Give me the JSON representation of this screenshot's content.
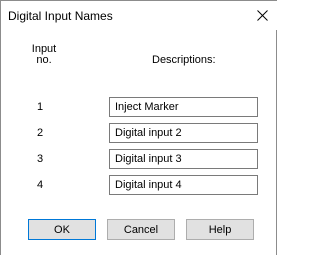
{
  "dialog": {
    "title": "Digital Input Names"
  },
  "headers": {
    "input_no_line1": "Input",
    "input_no_line2": "no.",
    "descriptions": "Descriptions:"
  },
  "rows": [
    {
      "no": "1",
      "description": "Inject Marker"
    },
    {
      "no": "2",
      "description": "Digital input 2"
    },
    {
      "no": "3",
      "description": "Digital input 3"
    },
    {
      "no": "4",
      "description": "Digital input 4"
    }
  ],
  "buttons": {
    "ok": "OK",
    "cancel": "Cancel",
    "help": "Help"
  },
  "icons": {
    "close": "close-icon"
  }
}
